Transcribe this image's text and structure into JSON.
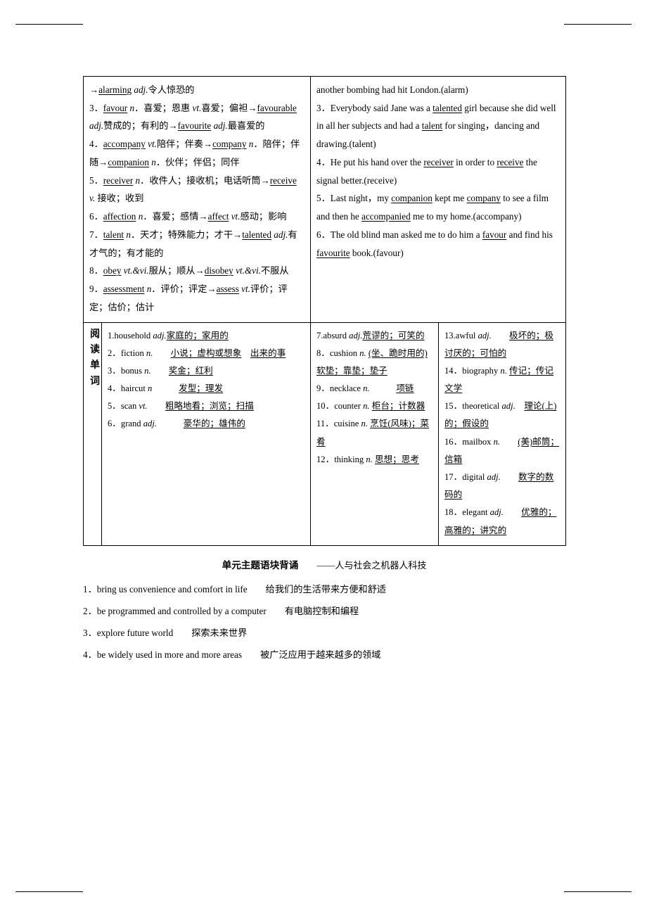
{
  "table": {
    "row1": {
      "left": [
        "→<u>alarming</u> <i>adj.</i>令人惊恐的",
        "3．<u>favour</u> <i>n</i>．喜爱；恩惠 <i>vt.</i>喜爱；偏袒→<u>favourable</u> <i>adj.</i>赞成的；有利的→<u>favourite</u> <i>adj.</i>最喜爱的",
        "4．<u>accompany</u> <i>vt.</i>陪伴；伴奏→<u>company</u> <i>n</i>．陪伴；伴随→<u>companion</u> <i>n</i>．伙伴；伴侣；同伴",
        "5．<u>receiver</u> <i>n</i>．收件人；接收机；电话听筒→<u>receive</u> <i>v.</i> 接收；收到",
        "6．<u>affection</u> <i>n</i>．喜爱；感情→<u>affect</u> <i>vt.</i>感动；影响",
        "7．<u>talent</u> <i>n</i>．天才；特殊能力；才干→<u>talented</u> <i>adj.</i>有才气的；有才能的",
        "8．<u>obey</u> <i>vt.&amp;vi.</i>服从；顺从→<u>disobey</u> <i>vt.&amp;vi.</i>不服从",
        "9．<u>assessment</u> <i>n</i>．评价；评定→<u>assess</u> <i>vt.</i>评价；评定；估价；估计"
      ],
      "right": [
        "another bombing had hit London.(alarm)",
        "3．Everybody said Jane was a <u>talented</u> girl because she did well in all her subjects and had a <u>talent</u> for singing，dancing and drawing.(talent)",
        "4．He put his hand over the <u>receiver</u> in order to <u>receive</u> the signal better.(receive)",
        "5．Last night，my <u>companion</u> kept me <u>company</u> to see a film and then he <u>accompanied</u> me to my home.(accompany)",
        "6．The old blind man asked me to do him a <u>favour</u> and find his <u>favourite</u> book.(favour)"
      ]
    },
    "row2": {
      "label": "阅读单词",
      "col1": [
        "1.household <i>adj.</i><u>家庭的；家用的</u>",
        "2．fiction <i>n.</i>　　<u>小说；虚构或想象</u>　<u>出来的事</u>",
        "3．bonus <i>n.</i>　　<u>奖金；红利</u>",
        "4．haircut <i>n</i>　　　<u>发型；理发</u>",
        "5．scan <i>vt.</i>　　<u>粗略地看；浏览；扫描</u>",
        "6．grand <i>adj.</i>　　　<u>豪华的；雄伟的</u>"
      ],
      "col2": [
        "7.absurd <i>adj.</i><u>荒谬的；可笑的</u>",
        "8．cushion <i>n.</i> <u>(坐、跪时用的)软垫；靠垫；垫子</u>",
        "9．necklace <i>n.</i>　　　<u>项链</u>",
        "10．counter <i>n.</i> <u>柜台；计数器</u>",
        "11．cuisine <i>n.</i> <u>烹饪(风味)；菜肴</u>",
        "12．thinking <i>n.</i> <u>思想；思考</u>"
      ],
      "col3": [
        "13.awful <i>adj.</i>　　<u>极坏的；极讨厌的；可怕的</u>",
        "14．biography <i>n.</i> <u>传记；传记文学</u>",
        "15．theoretical <i>adj.</i>　<u>理论(上)的；假设的</u>",
        "16．mailbox <i>n.</i>　　<u>(美)邮筒；信箱</u>",
        "17．digital <i>adj.</i>　　<u>数字的数码的</u>",
        "18．elegant <i>adj.</i>　　<u>优雅的；高雅的；讲究的</u>"
      ]
    }
  },
  "bottom": {
    "title": "单元主题语块背诵",
    "subtitle": "——人与社会之机器人科技",
    "items": [
      {
        "num": "1．",
        "en": "bring us convenience and comfort in life",
        "zh": "给我们的生活带来方便和舒适"
      },
      {
        "num": "2．",
        "en": "be programmed and controlled by a computer",
        "zh": "有电脑控制和编程"
      },
      {
        "num": "3．",
        "en": "explore future world",
        "zh": "探索未来世界"
      },
      {
        "num": "4．",
        "en": "be widely used in more and more areas",
        "zh": "被广泛应用于越来越多的领域"
      }
    ]
  }
}
